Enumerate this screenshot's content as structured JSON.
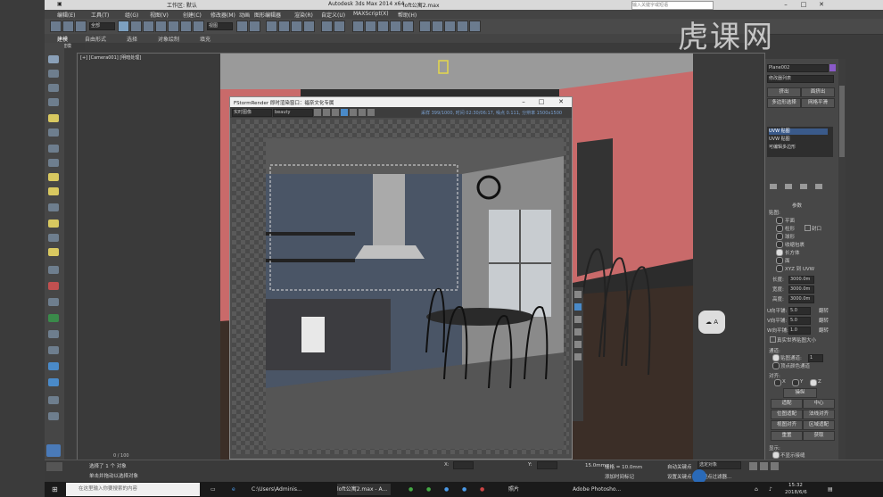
{
  "titlebar": {
    "workspace": "工作区: 默认",
    "app_title": "Autodesk 3ds Max  2014 x64",
    "file": "loft公寓2.max",
    "search_placeholder": "输入关键字或短语"
  },
  "menu": [
    "编辑(E)",
    "工具(T)",
    "组(G)",
    "视图(V)",
    "创建(C)",
    "修改器(M)",
    "动画",
    "图形编辑器",
    "渲染(R)",
    "自定义(U)",
    "MAXScript(X)",
    "帮助(H)"
  ],
  "toolbar": {
    "selection_filter": "全部",
    "named_sel": "视图"
  },
  "ribbon": [
    "建模",
    "自由形式",
    "选择",
    "对象绘制",
    "填充"
  ],
  "ribbon_sub": "多边形建模",
  "viewport": {
    "label": "[+] [Camera001] [明暗处理]",
    "timeline": "0 / 100"
  },
  "fstorm": {
    "title": "FStormRender 即时渲染窗口：福奈文化专属",
    "dropdown1": "实时图像",
    "dropdown2": "beauty",
    "status": "采样 399/1000, 时间 02:30/06:17, 噪点 0.111, 分辨率 1500x1500"
  },
  "cmdpanel": {
    "object_name": "Plane002",
    "modifier_list": "修改器列表",
    "btn1": "挤出",
    "btn2": "面挤出",
    "btn3": "多边形选择",
    "btn4": "网格平滑",
    "stack": [
      "UVW 贴图",
      "UVW 贴图",
      "可编辑多边形"
    ],
    "params_title": "参数",
    "mapping_label": "贴图:",
    "mapping_options": [
      "平面",
      "柱形",
      "封口",
      "球形",
      "收缩包裹",
      "长方体",
      "面",
      "XYZ 到 UVW"
    ],
    "length_label": "长度:",
    "length": "3000.0m",
    "width_label": "宽度:",
    "width": "3000.0m",
    "height_label": "高度:",
    "height": "3000.0m",
    "u_tile_label": "U向平铺:",
    "u_tile": "5.0",
    "v_tile_label": "V向平铺:",
    "v_tile": "5.0",
    "w_tile_label": "W向平铺:",
    "w_tile": "1.0",
    "flip_label": "翻转",
    "real_world": "真实世界贴图大小",
    "channel_title": "通道:",
    "channel_map": "贴图通道:",
    "channel_value": "1",
    "vertex_color": "顶点颜色通道",
    "align_title": "对齐:",
    "axes": [
      "X",
      "Y",
      "Z"
    ],
    "align_btns": [
      "操纵",
      "适配",
      "中心",
      "位图适配",
      "法线对齐",
      "视图对齐",
      "区域适配",
      "重置",
      "获取"
    ],
    "display_title": "显示:",
    "no_seams": "不显示接缝"
  },
  "status": {
    "selected": "选择了 1 个 对象",
    "hint": "单击并拖动以选择对象",
    "x_label": "X:",
    "y_label": "Y:",
    "grid": "栅格 = 10.0mm",
    "grid_left": "15.0mm",
    "add_tag": "添加时间标记",
    "auto_key": "自动关键点",
    "set_key": "设置关键点",
    "filter": "关键点过滤器...",
    "selected_obj": "选定对象"
  },
  "taskbar": {
    "search_placeholder": "在这里输入你要搜索的内容",
    "items": [
      "C:\\Users\\Adminis...",
      "loft公寓2.max - A...",
      "照片",
      "Adobe Photosho..."
    ],
    "time": "15:32",
    "date": "2018/6/6"
  },
  "watermark": "虎课网",
  "colors": {
    "accent": "#6b7b8e",
    "pink_wall": "#c96a6a",
    "stack_highlight": "#3a5a8a"
  }
}
